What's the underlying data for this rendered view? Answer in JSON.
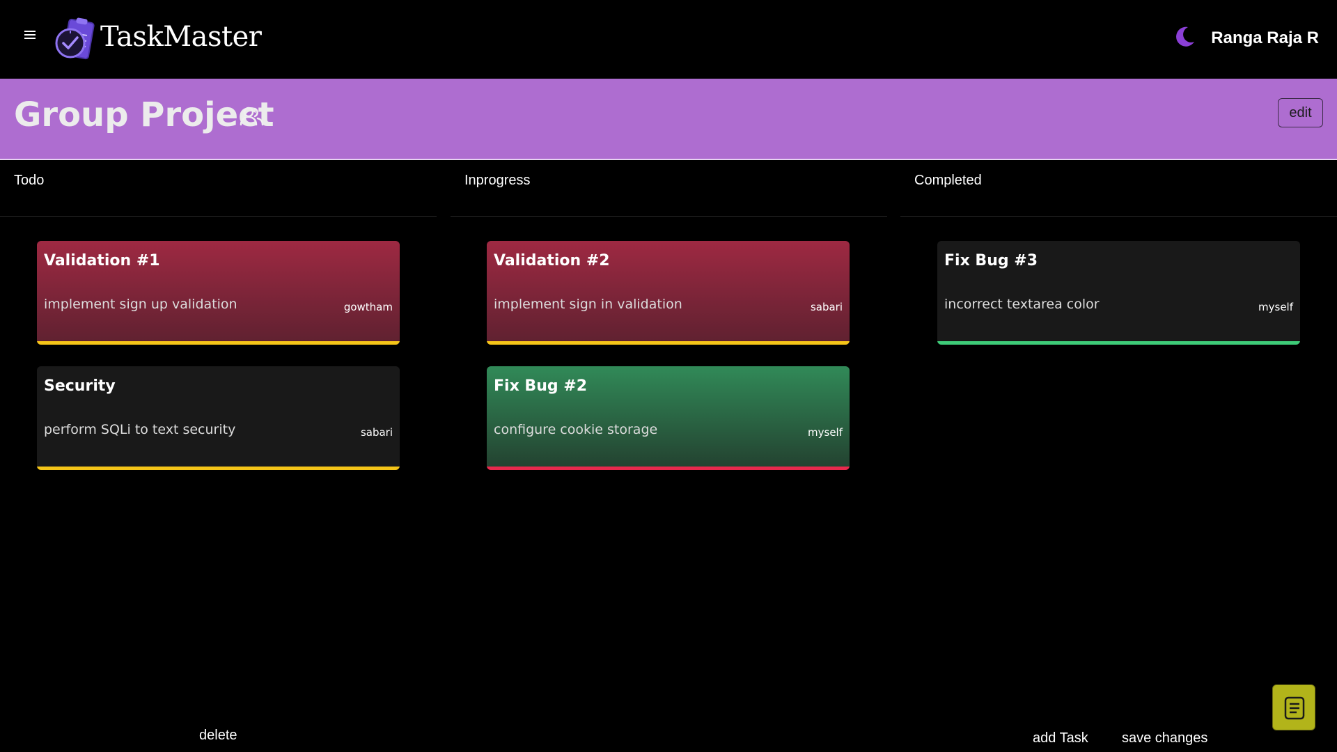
{
  "app": {
    "brand": "TaskMaster",
    "user_name": "Ranga Raja R"
  },
  "project": {
    "title": "Group Project",
    "edit_label": "edit"
  },
  "columns": [
    {
      "title": "Todo"
    },
    {
      "title": "Inprogress"
    },
    {
      "title": "Completed"
    }
  ],
  "cards": [
    {
      "title": "Validation #1",
      "description": "implement sign up validation",
      "assignee": "gowtham",
      "style": "red",
      "bar_color": "#f5c518"
    },
    {
      "title": "Security",
      "description": "perform SQLi to text security",
      "assignee": "sabari",
      "style": "dark",
      "bar_color": "#f5c518"
    },
    {
      "title": "Validation #2",
      "description": "implement sign in validation",
      "assignee": "sabari",
      "style": "red",
      "bar_color": "#f5c518"
    },
    {
      "title": "Fix Bug #2",
      "description": "configure cookie storage",
      "assignee": "myself",
      "style": "green",
      "bar_color": "#e8294d"
    },
    {
      "title": "Fix Bug #3",
      "description": "incorrect textarea color",
      "assignee": "myself",
      "style": "dark",
      "bar_color": "#3ecb78"
    }
  ],
  "footer": {
    "delete_label": "delete",
    "add_task_label": "add Task",
    "save_label": "save changes"
  },
  "icons": {
    "menu": "hamburger-menu-icon",
    "logo": "clipboard-clock-logo",
    "theme": "moon-icon",
    "group": "group-icon",
    "notes": "notes-icon"
  },
  "colors": {
    "banner": "#ae6dd0",
    "accent_purple": "#8b3fd6",
    "notes_button": "#b2b41a",
    "priority_yellow": "#f5c518",
    "priority_red": "#e8294d",
    "priority_green": "#3ecb78"
  }
}
